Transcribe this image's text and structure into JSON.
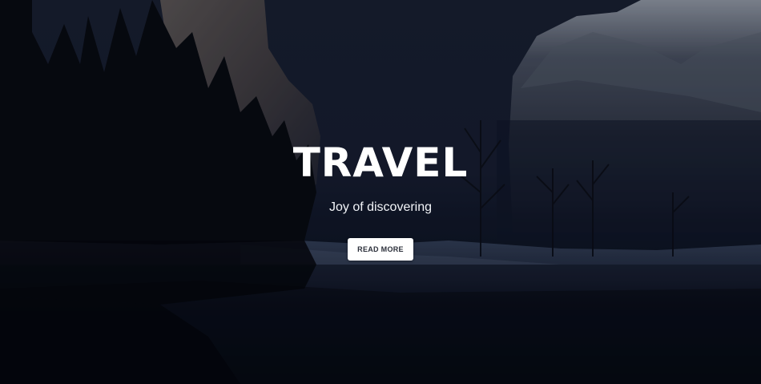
{
  "hero": {
    "title": "TRAVEL",
    "subtitle": "Joy of discovering",
    "button_label": "READ MORE"
  },
  "colors": {
    "sky": "#1b2233",
    "water": "#070b14",
    "text": "#ffffff",
    "button_bg": "#ffffff",
    "button_text": "#2b2f3a"
  }
}
